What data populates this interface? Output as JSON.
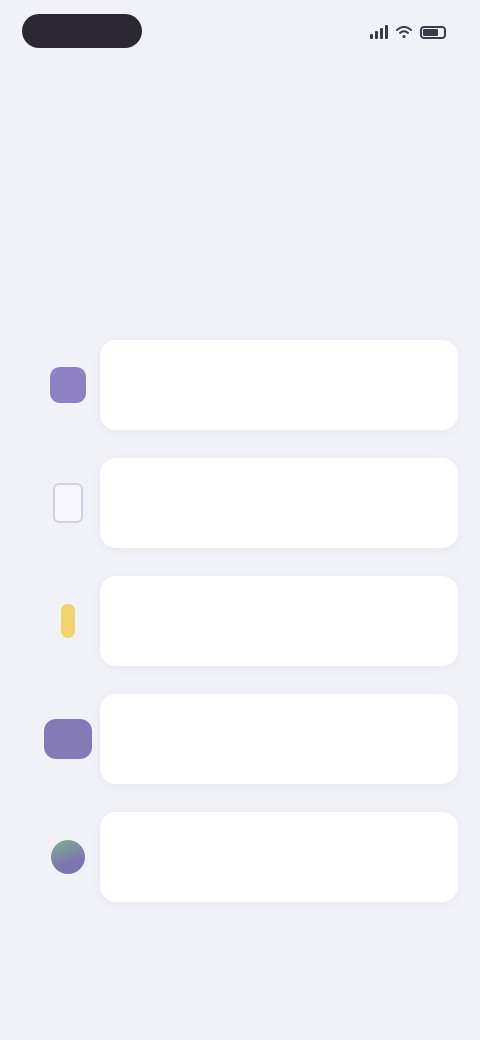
{
  "status_bar": {
    "time": "",
    "signal_icon": "signal-icon",
    "wifi_icon": "wifi-icon",
    "battery_icon": "battery-icon"
  },
  "nav": {
    "back_label": ""
  },
  "headline": "",
  "options": [
    {
      "icon": "chat-icon",
      "label": ""
    },
    {
      "icon": "document-icon",
      "label": ""
    },
    {
      "icon": "lightbulb-icon",
      "label": ""
    },
    {
      "icon": "group-icon",
      "label": ""
    },
    {
      "icon": "globe-icon",
      "label": ""
    }
  ],
  "colors": {
    "background": "#f1f1f8",
    "card": "#ffffff",
    "accent_purple": "#8e82c4",
    "accent_yellow": "#f0d36a",
    "accent_green": "#7cb38c",
    "status_pill": "#2b2733"
  }
}
